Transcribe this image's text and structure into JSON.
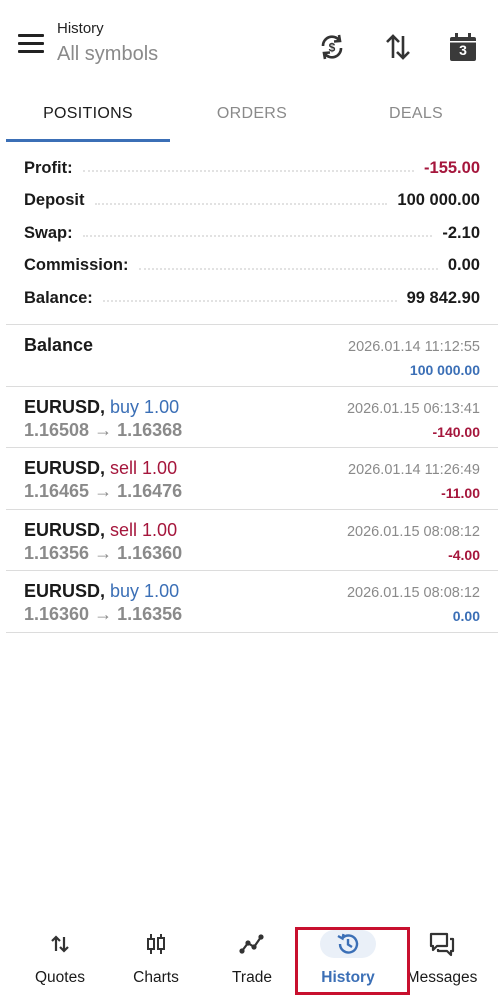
{
  "header": {
    "title": "History",
    "subtitle": "All symbols",
    "icons": [
      "menu-icon",
      "sync-icon",
      "sort-icon",
      "calendar-icon"
    ],
    "calendar_day": "3"
  },
  "tabs": [
    {
      "label": "POSITIONS",
      "active": true
    },
    {
      "label": "ORDERS",
      "active": false
    },
    {
      "label": "DEALS",
      "active": false
    }
  ],
  "summary": [
    {
      "label": "Profit:",
      "value": "-155.00",
      "negative": true
    },
    {
      "label": "Deposit",
      "value": "100 000.00",
      "negative": false
    },
    {
      "label": "Swap:",
      "value": "-2.10",
      "negative": false
    },
    {
      "label": "Commission:",
      "value": "0.00",
      "negative": false
    },
    {
      "label": "Balance:",
      "value": "99 842.90",
      "negative": false
    }
  ],
  "balance_entry": {
    "label": "Balance",
    "time": "2026.01.14 11:12:55",
    "amount": "100 000.00"
  },
  "deals": [
    {
      "symbol": "EURUSD,",
      "side": "buy 1.00",
      "side_type": "buy",
      "prices": "1.16508 → 1.16368",
      "time": "2026.01.15 06:13:41",
      "profit": "-140.00",
      "negative": true
    },
    {
      "symbol": "EURUSD,",
      "side": "sell 1.00",
      "side_type": "sell",
      "prices": "1.16465 → 1.16476",
      "time": "2026.01.14 11:26:49",
      "profit": "-11.00",
      "negative": true
    },
    {
      "symbol": "EURUSD,",
      "side": "sell 1.00",
      "side_type": "sell",
      "prices": "1.16356 → 1.16360",
      "time": "2026.01.15 08:08:12",
      "profit": "-4.00",
      "negative": true
    },
    {
      "symbol": "EURUSD,",
      "side": "buy 1.00",
      "side_type": "buy",
      "prices": "1.16360 → 1.16356",
      "time": "2026.01.15 08:08:12",
      "profit": "0.00",
      "negative": false
    }
  ],
  "bottom_nav": [
    {
      "label": "Quotes",
      "icon": "quotes-icon",
      "active": false
    },
    {
      "label": "Charts",
      "icon": "charts-icon",
      "active": false
    },
    {
      "label": "Trade",
      "icon": "trade-icon",
      "active": false
    },
    {
      "label": "History",
      "icon": "history-icon",
      "active": true
    },
    {
      "label": "Messages",
      "icon": "messages-icon",
      "active": false
    }
  ],
  "colors": {
    "accent": "#3b6fb6",
    "negative": "#a5163c",
    "highlight": "#c8102e"
  }
}
